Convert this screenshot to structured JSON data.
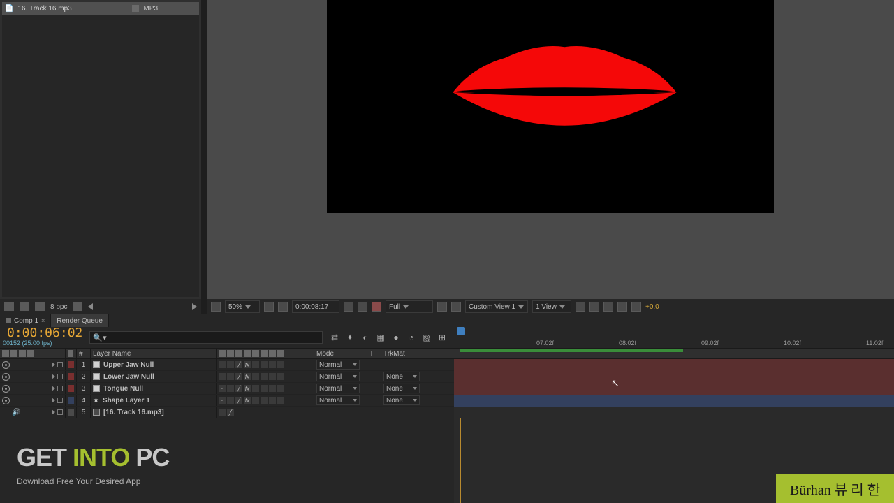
{
  "project": {
    "item_name": "16. Track 16.mp3",
    "item_type": "MP3",
    "bpc": "8 bpc"
  },
  "viewport": {
    "zoom": "50%",
    "timecode": "0:00:08:17",
    "resolution": "Full",
    "view_mode": "Custom View 1",
    "views": "1 View",
    "exposure": "+0.0"
  },
  "tabs": {
    "active": "Comp 1",
    "inactive": "Render Queue"
  },
  "timeline": {
    "timecode": "0:00:06:02",
    "frameinfo": "00152 (25.00 fps)",
    "ruler": [
      "07:02f",
      "08:02f",
      "09:02f",
      "10:02f",
      "11:02f"
    ]
  },
  "columns": {
    "num": "#",
    "layer_name": "Layer Name",
    "mode": "Mode",
    "t": "T",
    "trkmat": "TrkMat"
  },
  "layers": [
    {
      "num": "1",
      "name": "Upper Jaw Null",
      "color": "#7a2f2f",
      "mode": "Normal",
      "trk": ""
    },
    {
      "num": "2",
      "name": "Lower Jaw Null",
      "color": "#7a2f2f",
      "mode": "Normal",
      "trk": "None"
    },
    {
      "num": "3",
      "name": "Tongue Null",
      "color": "#7a2f2f",
      "mode": "Normal",
      "trk": "None"
    },
    {
      "num": "4",
      "name": "Shape Layer 1",
      "color": "#33405e",
      "mode": "Normal",
      "trk": "None",
      "star": true
    },
    {
      "num": "5",
      "name": "[16. Track 16.mp3]",
      "color": "#4a4a4a",
      "mode": "",
      "trk": "",
      "audio": true
    }
  ],
  "watermark": {
    "line1a": "GET ",
    "line1b": "INTO",
    "line1c": " PC",
    "line2": "Download Free Your Desired App"
  },
  "credit": "Bürhan  뷰 리 한"
}
